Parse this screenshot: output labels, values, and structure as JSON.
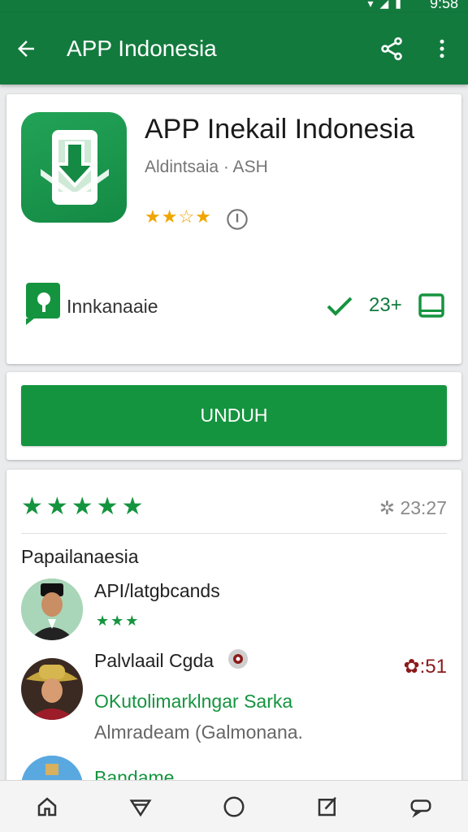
{
  "status": {
    "time": "9:58",
    "icons": [
      "signal-icon",
      "wifi-icon",
      "battery-icon"
    ]
  },
  "appbar": {
    "title": "APP Indonesia",
    "back_icon": "arrow-left-icon",
    "share_icon": "share-icon",
    "more_icon": "more-vert-icon"
  },
  "app": {
    "name": "APP Inekail Indonesia",
    "developer": "Aldintsaia · ASH",
    "rating_stars": "★★☆★",
    "developer_label": "Innkanaaie",
    "age_rating": "23+"
  },
  "install": {
    "label": "UNDUH",
    "color": "#15943f"
  },
  "reviews": {
    "summary_stars": "★★★★★",
    "summary_meta": "23:27",
    "section_title": "Papailanaesia",
    "items": [
      {
        "name": "API/latgbcands",
        "stars": "★★★",
        "sub": "",
        "text": "",
        "side": ""
      },
      {
        "name": "Palvlaail Cgda",
        "stars": "",
        "sub": "OKutolimarklngar Sarka",
        "text": "Almradeam (Galmonana.",
        "side": "51"
      },
      {
        "name": "Bandame",
        "stars": "",
        "sub": "",
        "text": "",
        "side": ""
      }
    ]
  },
  "nav": {
    "items": [
      "home-icon",
      "filter-icon",
      "circle-icon",
      "edit-icon",
      "chat-icon"
    ]
  },
  "colors": {
    "primary": "#137a3e",
    "accent": "#15943f",
    "star": "#f0a500"
  }
}
